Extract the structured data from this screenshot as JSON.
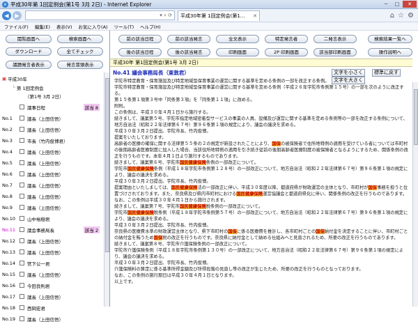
{
  "window": {
    "title": "平成30年第 1回定例会(第1号 3月 2日) - Internet Explorer"
  },
  "tab": {
    "title": "平成30年第 1回定例会(第1..."
  },
  "menu": [
    "ファイル(F)",
    "編集(E)",
    "表示(V)",
    "お気に入り(A)",
    "ツール(T)",
    "ヘルプ(H)"
  ],
  "left_buttons": {
    "prev_screen": "閲覧画面へ",
    "search_screen": "検索画面へ",
    "download": "ダウンロード",
    "check_all": "全てチェック",
    "speaker_display": "議題発言者表示",
    "speaker_index": "発言冒頭表示"
  },
  "toolbar": {
    "row1": [
      "前の該当日程",
      "前の該当発言",
      "全文表示",
      "特定発言者",
      "二発言表示",
      "検索結果一覧へ"
    ],
    "row2": [
      "後の該当日程",
      "後の該当発言",
      "印刷画面",
      "2P 印刷画面",
      "該当部印刷画面",
      "操作説明へ"
    ]
  },
  "tree": {
    "year": "平成30年",
    "session": "第 1回定例会",
    "meeting": "（第1号 3月 2日）"
  },
  "speakers": [
    {
      "no": "",
      "name": "議事日程",
      "tag": "該当 8"
    },
    {
      "no": "No.1",
      "name": "議長（上田信悟）",
      "tag": ""
    },
    {
      "no": "No.2",
      "name": "議長（上田信悟）",
      "tag": ""
    },
    {
      "no": "No.3",
      "name": "市長（竹内俊博君）",
      "tag": ""
    },
    {
      "no": "No.4",
      "name": "議長（上田信悟）",
      "tag": ""
    },
    {
      "no": "No.5",
      "name": "議長（上田信悟）",
      "tag": ""
    },
    {
      "no": "No.6",
      "name": "議長（上田信悟）",
      "tag": ""
    },
    {
      "no": "No.7",
      "name": "議長（上田信悟）",
      "tag": ""
    },
    {
      "no": "No.8",
      "name": "議長（上田信悟）",
      "tag": ""
    },
    {
      "no": "No.9",
      "name": "議長（上田信悟）",
      "tag": ""
    },
    {
      "no": "No.10",
      "name": "山中裕樹君",
      "tag": ""
    },
    {
      "no": "No.11",
      "name": "議会事務局長",
      "tag": "該当 2",
      "active": true
    },
    {
      "no": "No.12",
      "name": "議長（上田信悟）",
      "tag": ""
    },
    {
      "no": "No.13",
      "name": "議長（上田信悟）",
      "tag": ""
    },
    {
      "no": "No.14",
      "name": "宮下公一君",
      "tag": ""
    },
    {
      "no": "No.15",
      "name": "議長（上田信悟）",
      "tag": ""
    },
    {
      "no": "No.16",
      "name": "今田良則君",
      "tag": ""
    },
    {
      "no": "No.17",
      "name": "議長（上田信悟）",
      "tag": ""
    },
    {
      "no": "No.18",
      "name": "西岡宏君",
      "tag": ""
    },
    {
      "no": "No.19",
      "name": "議長（上田信悟）",
      "tag": ""
    }
  ],
  "content": {
    "session_title": "平成30年 第1回定例会(第1号 3月 2日)",
    "speaker_heading": "No.41 議会事務局長（東敦君）",
    "font_small": "文字を小さく",
    "font_reset": "標準に戻す",
    "font_large": "文字を大きく",
    "paragraphs": [
      "宇陀市特定教育・保育施設及び特定地域型保育事業の運営に関する基準を定める条例の一部を改正する条例。",
      "宇陀市特定教育・保育施設及び特定地域型保育事業の運営に関する基準を定める条例（平成２６年宇陀市条例第１５号）の一部を次のように改正する。",
      "第１５条第１項第３号中「同条第３項」を「同条第１１項」に改める。",
      "附則。",
      "この条例は、平成３０年４月１日から施行する。",
      "続きまして、議案第５号、宇陀市指定地域密着型サービスの事業の人員、設備及び運営に関する基準を定める条例等の一部を改正する条例について、地方自治法（昭和２２年法律第６７号）第９６条第１項の規定により、議会の議決を求める。",
      "平成３０年３月２日提出、宇陀市長、竹内俊博。",
      "提案をいたしております。",
      "高齢者の医療の確保に関する法律第５５条の２の規定が新設されたことにより、国保の被保険者で住所地特例の適用を受けている者については市町村の後期高齢者医療制度に加入した場合、当該住所地特例の適用を引き続き従前の後期高齢者医療制度の被保険者となるようにするため、関係条例の改正を行うものです。本年４月１日より施行するものであります。",
      "続きまして、議案第６号、宇陀市国民健康保険条例の一部改正について。",
      "宇陀市国民健康保険条例（平成１８年宇陀市条例第１２８号）の一部改正について、地方自治法（昭和２２年法律第６７号）第９６条第１項の規定により、議会の議決を求める。",
      "平成３０年３月２日提出、宇陀市長、竹内俊博。",
      "提案理由といたしましては、国民健康保険法の一部改正に伴い、平成３０年度以降、都道府県が財政運営の主体となり、市町村が国保事務を担うと位置づけされております。また、奈良県及び県内市町村における国民健康保険運営協議会と都道府県化に伴い、関係条例の改正を行うものであります。",
      "なお、この条例は平成３０年４月１日から施行されます。",
      "続きまして、議案第７号、宇陀市国民健康保険税条例の一部改正について。",
      "宇陀市国民健康保険税条例（平成１８年宇陀市条例第５７号）の一部改正について、地方自治法（昭和２２年法律第６７号）第９６条第１項の規定により、議会の議決を求める。",
      "平成３０年３月２日提出、宇陀市長、竹内俊博。",
      "奈良県の医療費水準の財政運営主体となり、県下市町村の国保に係る医療費を推計し、各市町村ごとの国保納付金を決定することに伴い、市町村ごとの納付金を賄うため国保税の改正を行うものです。奈良県に納付金として納める仕組みへと見直されるため、所要の改正を行うものであります。",
      "続きまして、議案第８号、宇陀市介護保険条例の一部改正について。",
      "宇陀市介護保険条例（平成１８年宇陀市条例第１３０号）の一部改正について、地方自治法（昭和２２年法律第６７号）第９６条第１項の規定により、議会の議決を求める。",
      "平成３０年３月２日提出、宇陀市長、竹内俊博。",
      "介護保険料の算定に係る基準所得金額及び所得段階の見直し等の改正が生じたため、所要の改正を行うものとなっております。",
      "なお、この条例の施行期日は平成３０年４月１日となります。",
      "以上です。"
    ]
  },
  "colors": {
    "highlight_bg": "#f5c242",
    "highlight_text": "#c40000",
    "session_bar": "#fffbd2",
    "speaker_head": "#1a2ab8"
  }
}
